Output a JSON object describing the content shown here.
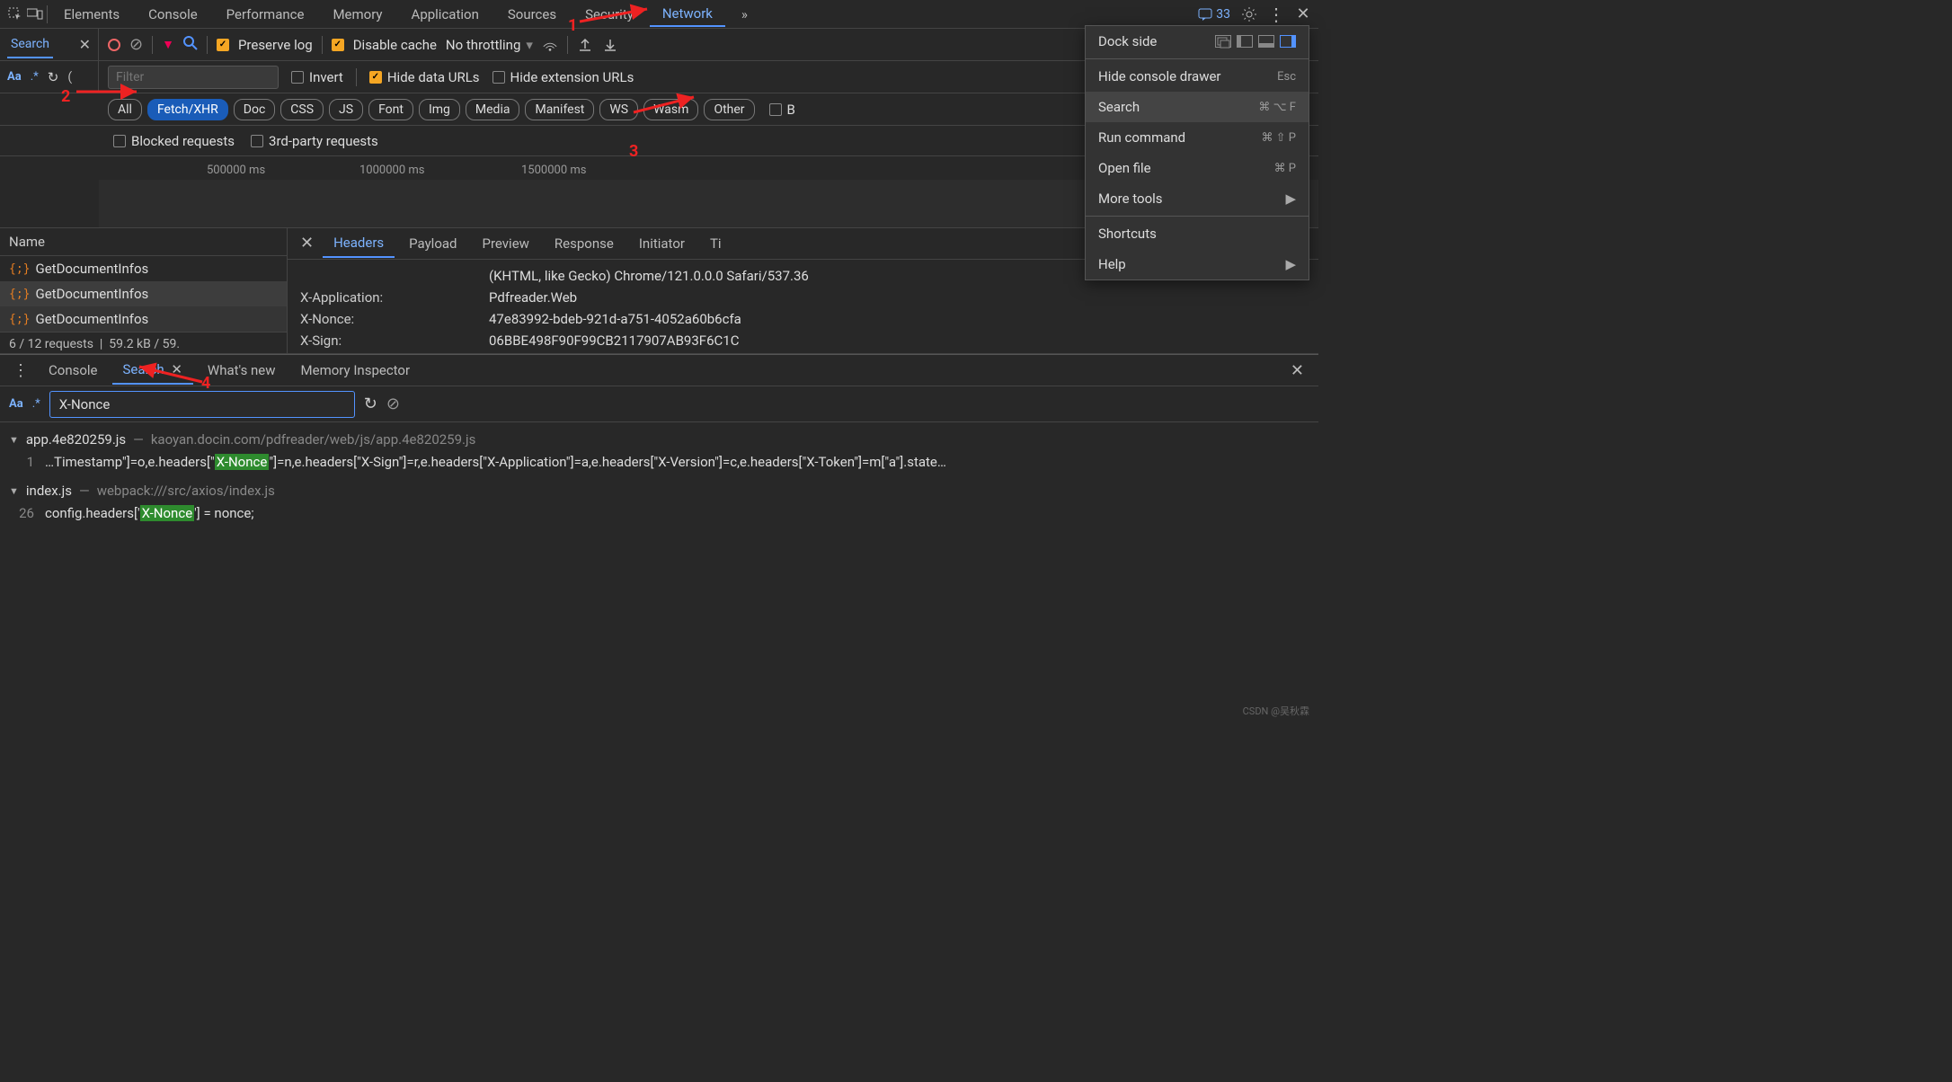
{
  "tabs": {
    "elements": "Elements",
    "console": "Console",
    "performance": "Performance",
    "memory": "Memory",
    "application": "Application",
    "sources": "Sources",
    "security": "Security",
    "network": "Network",
    "more": "»",
    "msg_count": "33"
  },
  "sidebar": {
    "search": "Search"
  },
  "toolbar": {
    "preserve": "Preserve log",
    "disable_cache": "Disable cache",
    "throttling": "No throttling"
  },
  "filter": {
    "placeholder": "Filter",
    "invert": "Invert",
    "hide_data": "Hide data URLs",
    "hide_ext": "Hide extension URLs"
  },
  "pills": {
    "all": "All",
    "fetch": "Fetch/XHR",
    "doc": "Doc",
    "css": "CSS",
    "js": "JS",
    "font": "Font",
    "img": "Img",
    "media": "Media",
    "manifest": "Manifest",
    "ws": "WS",
    "wasm": "Wasm",
    "other": "Other",
    "blocked_resp": "B"
  },
  "row4": {
    "blocked": "Blocked requests",
    "third": "3rd-party requests"
  },
  "timeline": {
    "t1": "500000 ms",
    "t2": "1000000 ms",
    "t3": "1500000 ms"
  },
  "reqlist": {
    "hdr": "Name",
    "r1": "GetDocumentInfos",
    "r2": "GetDocumentInfos",
    "r3": "GetDocumentInfos",
    "stat1": "6 / 12 requests",
    "stat2": "59.2 kB / 59."
  },
  "dtabs": {
    "headers": "Headers",
    "payload": "Payload",
    "preview": "Preview",
    "response": "Response",
    "initiator": "Initiator",
    "timing": "Ti"
  },
  "headers": {
    "ua_val": "(KHTML, like Gecko) Chrome/121.0.0.0 Safari/537.36",
    "xapp_k": "X-Application:",
    "xapp_v": "Pdfreader.Web",
    "xnonce_k": "X-Nonce:",
    "xnonce_v": "47e83992-bdeb-921d-a751-4052a60b6cfa",
    "xsign_k": "X-Sign:",
    "xsign_v": "06BBE498F90F99CB2117907AB93F6C1C"
  },
  "drawer": {
    "console": "Console",
    "search": "Search",
    "whatsnew": "What's new",
    "memory": "Memory Inspector"
  },
  "search": {
    "value": "X-Nonce"
  },
  "results": {
    "f1_name": "app.4e820259.js",
    "f1_path": "kaoyan.docin.com/pdfreader/web/js/app.4e820259.js",
    "f1_line": "1",
    "f1_pre": "…Timestamp\"]=o,e.headers[\"",
    "f1_hl": "X-Nonce",
    "f1_post": "\"]=n,e.headers[\"X-Sign\"]=r,e.headers[\"X-Application\"]=a,e.headers[\"X-Version\"]=c,e.headers[\"X-Token\"]=m[\"a\"].state…",
    "f2_name": "index.js",
    "f2_path": "webpack:///src/axios/index.js",
    "f2_line": "26",
    "f2_pre": "config.headers['",
    "f2_hl": "X-Nonce",
    "f2_post": "'] = nonce;"
  },
  "dropdown": {
    "dock": "Dock side",
    "hide_drawer": "Hide console drawer",
    "hide_drawer_kbd": "Esc",
    "search": "Search",
    "search_kbd": "⌘ ⌥ F",
    "run": "Run command",
    "run_kbd": "⌘ ⇧ P",
    "open": "Open file",
    "open_kbd": "⌘ P",
    "more": "More tools",
    "shortcuts": "Shortcuts",
    "help": "Help"
  },
  "annotations": {
    "n1": "1",
    "n2": "2",
    "n3": "3",
    "n4": "4"
  },
  "watermark": "CSDN @吴秋霖"
}
